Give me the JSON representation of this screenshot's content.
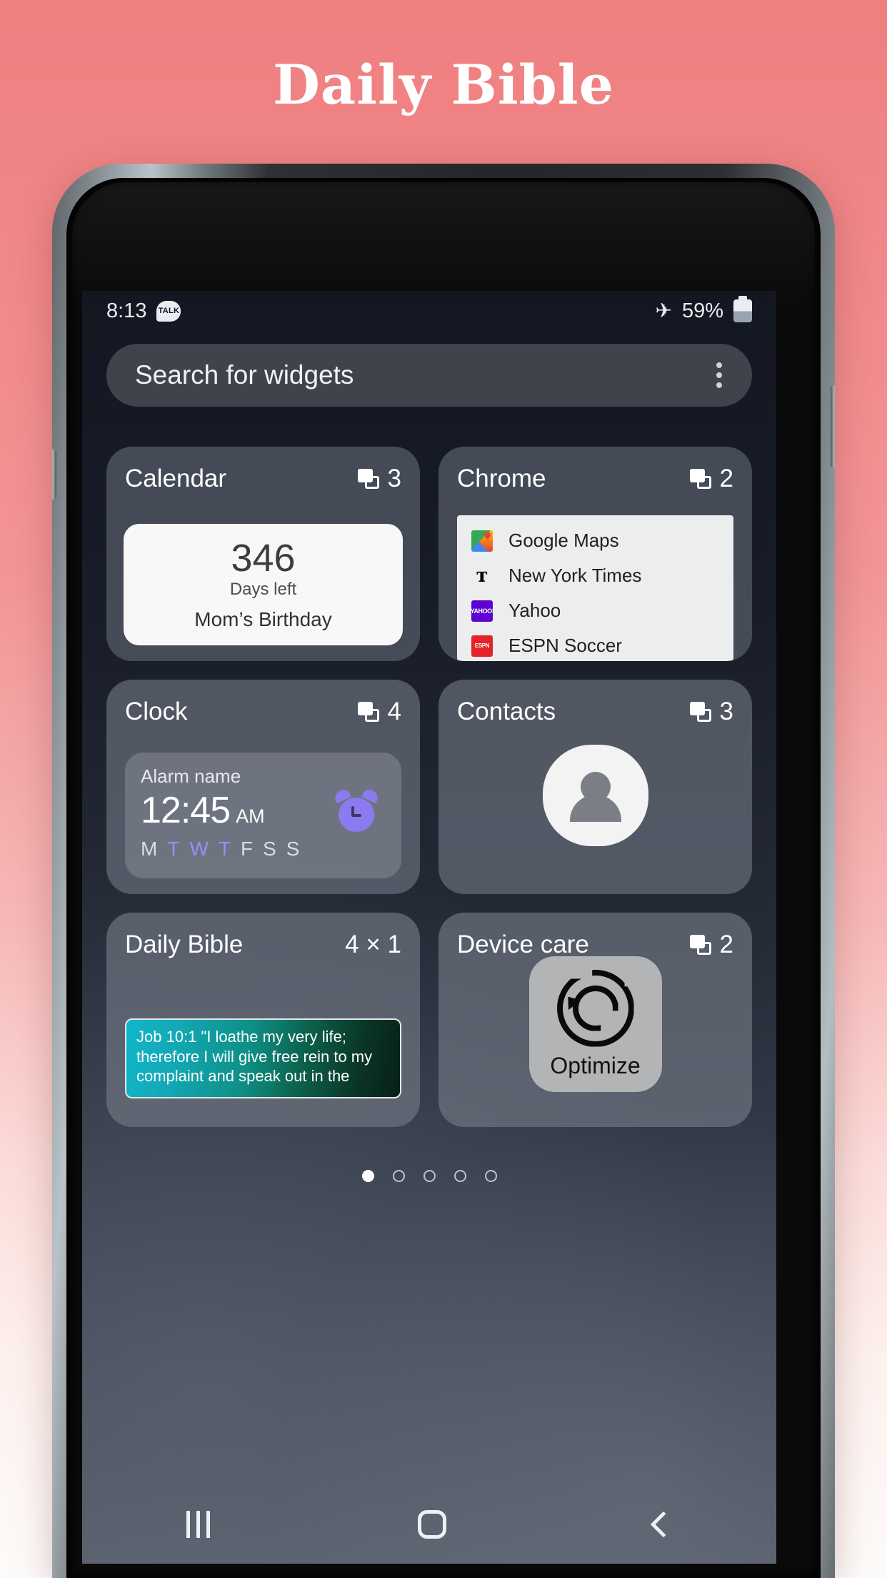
{
  "promo": {
    "title": "Daily Bible"
  },
  "status_bar": {
    "time": "8:13",
    "talk_icon_label": "TALK",
    "airplane_glyph": "✈",
    "battery_percent": "59%"
  },
  "search": {
    "placeholder": "Search for widgets",
    "overflow_label": "More options"
  },
  "widgets": [
    {
      "title": "Calendar",
      "count": "3",
      "preview": {
        "number": "346",
        "subtitle": "Days left",
        "event": "Mom’s Birthday"
      }
    },
    {
      "title": "Chrome",
      "count": "2",
      "links": [
        {
          "icon": "google-maps-icon",
          "label": "Google Maps",
          "mark": ""
        },
        {
          "icon": "new-york-times-icon",
          "label": "New York Times",
          "mark": "ᴛ"
        },
        {
          "icon": "yahoo-icon",
          "label": "Yahoo",
          "mark": "YAHOO!"
        },
        {
          "icon": "espn-icon",
          "label": "ESPN Soccer",
          "mark": "ESPN"
        }
      ]
    },
    {
      "title": "Clock",
      "count": "4",
      "alarm": {
        "name": "Alarm name",
        "time": "12:45",
        "meridiem": "AM",
        "days": [
          {
            "letter": "M",
            "active": false
          },
          {
            "letter": "T",
            "active": true
          },
          {
            "letter": "W",
            "active": true
          },
          {
            "letter": "T",
            "active": true
          },
          {
            "letter": "F",
            "active": false
          },
          {
            "letter": "S",
            "active": false
          },
          {
            "letter": "S",
            "active": false
          }
        ]
      }
    },
    {
      "title": "Contacts",
      "count": "3"
    },
    {
      "title": "Daily Bible",
      "size": "4 × 1",
      "verse": "Job 10:1 \"I loathe my very life; therefore I will give free rein to my complaint and speak out in the"
    },
    {
      "title": "Device care",
      "count": "2",
      "optimize_label": "Optimize"
    }
  ],
  "page_indicator": {
    "total": 5,
    "active_index": 0
  },
  "nav_bar": {
    "recents_label": "Recents",
    "home_label": "Home",
    "back_label": "Back"
  },
  "colors": {
    "background_top": "#ef7f80",
    "background_bottom": "#fdfbfa",
    "accent_purple": "#8c7bf0",
    "bible_gradient_start": "#11b6c9",
    "bible_gradient_end": "#072018"
  }
}
